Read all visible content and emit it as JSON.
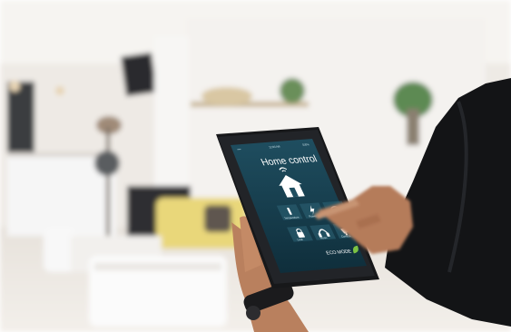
{
  "tablet": {
    "title": "Home control",
    "eco_label": "ECO MODE",
    "status_time": "12:00 AM",
    "status_left": "••••",
    "status_right": "100%",
    "tiles": [
      {
        "icon": "thermometer-icon",
        "label": "Temperature"
      },
      {
        "icon": "lightning-icon",
        "label": "Power"
      },
      {
        "icon": "wifi-icon",
        "label": "Wi-Fi"
      },
      {
        "icon": "lock-icon",
        "label": "Lock"
      },
      {
        "icon": "headphones-icon",
        "label": "Music"
      },
      {
        "icon": "camera-icon",
        "label": "Camera"
      }
    ]
  },
  "colors": {
    "screen_top": "#1f4e60",
    "screen_bottom": "#0f2e3b",
    "accent": "#ffffff",
    "eco_leaf": "#7cc243"
  }
}
